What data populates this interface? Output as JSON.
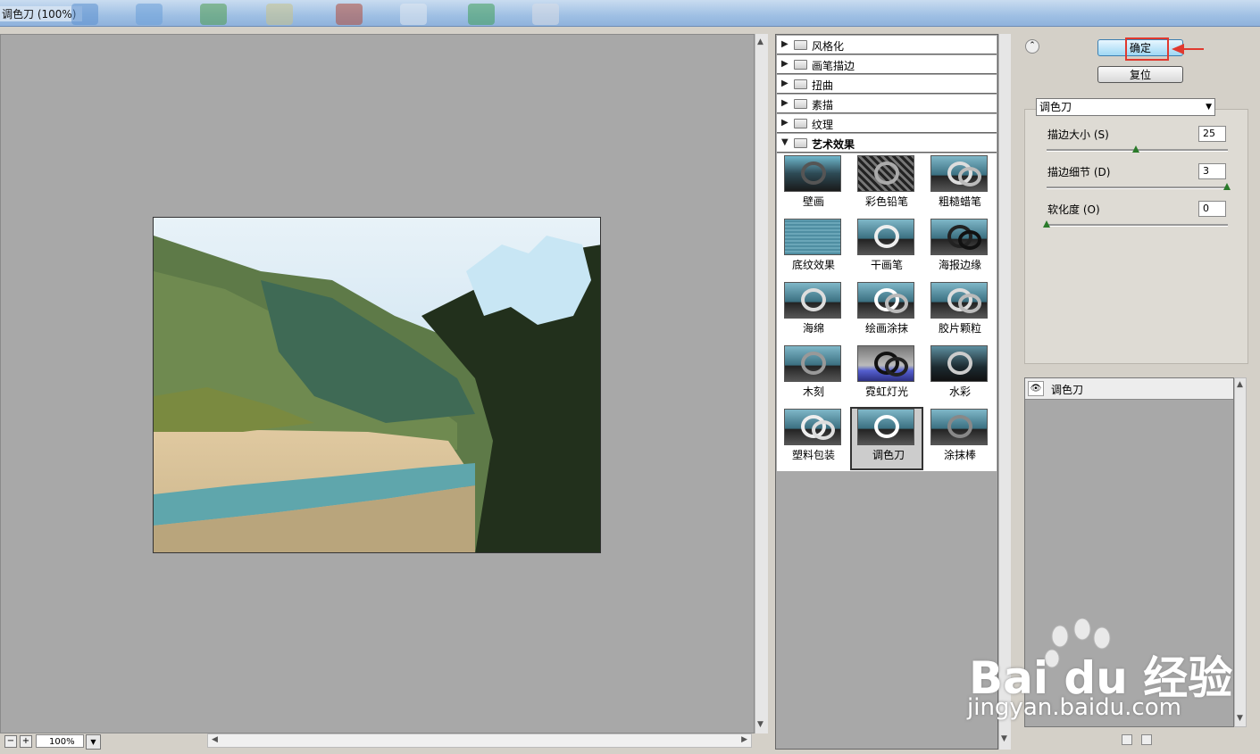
{
  "window": {
    "title": "调色刀 (100%)"
  },
  "zoom": {
    "value": "100%",
    "minus": "−",
    "plus": "+"
  },
  "categories": [
    {
      "label": "风格化",
      "open": false
    },
    {
      "label": "画笔描边",
      "open": false
    },
    {
      "label": "扭曲",
      "open": false
    },
    {
      "label": "素描",
      "open": false
    },
    {
      "label": "纹理",
      "open": false
    },
    {
      "label": "艺术效果",
      "open": true
    }
  ],
  "filters": [
    {
      "label": "壁画"
    },
    {
      "label": "彩色铅笔"
    },
    {
      "label": "粗糙蜡笔"
    },
    {
      "label": "底纹效果"
    },
    {
      "label": "干画笔"
    },
    {
      "label": "海报边缘"
    },
    {
      "label": "海绵"
    },
    {
      "label": "绘画涂抹"
    },
    {
      "label": "胶片颗粒"
    },
    {
      "label": "木刻"
    },
    {
      "label": "霓虹灯光"
    },
    {
      "label": "水彩"
    },
    {
      "label": "塑料包装"
    },
    {
      "label": "调色刀",
      "selected": true
    },
    {
      "label": "涂抹棒"
    }
  ],
  "buttons": {
    "ok": "确定",
    "reset": "复位"
  },
  "filter_select": {
    "value": "调色刀"
  },
  "params": [
    {
      "label": "描边大小 (S)",
      "value": "25",
      "level": 0.5
    },
    {
      "label": "描边细节 (D)",
      "value": "3",
      "level": 1.0
    },
    {
      "label": "软化度 (O)",
      "value": "0",
      "level": 0.0
    }
  ],
  "layers": [
    {
      "name": "调色刀",
      "visible": true
    }
  ],
  "watermark": {
    "brand": "Bai du 经验",
    "url": "jingyan.baidu.com"
  },
  "colors": {
    "accent_ok": "#9fd8f4",
    "highlight": "#e0392f"
  }
}
